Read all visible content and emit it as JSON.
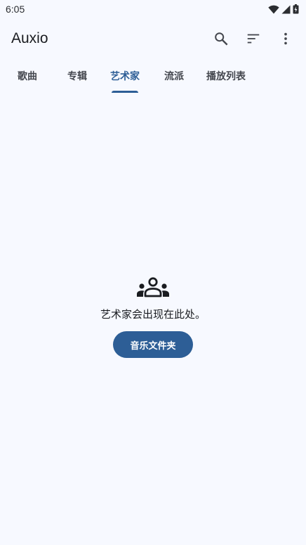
{
  "status_bar": {
    "time": "6:05",
    "icons": [
      "wifi-icon",
      "cellular-signal-icon",
      "battery-icon"
    ]
  },
  "app_bar": {
    "title": "Auxio",
    "actions": [
      "search-icon",
      "sort-icon",
      "more-vert-icon"
    ]
  },
  "tabs": [
    {
      "label": "歌曲",
      "active": false
    },
    {
      "label": "专辑",
      "active": false
    },
    {
      "label": "艺术家",
      "active": true
    },
    {
      "label": "流派",
      "active": false
    },
    {
      "label": "播放列表",
      "active": false
    }
  ],
  "empty_state": {
    "icon": "people-group-icon",
    "message": "艺术家会出现在此处。",
    "button_label": "音乐文件夹"
  },
  "colors": {
    "background": "#f7f9ff",
    "accent": "#2d5e96",
    "text_primary": "#1a1c20",
    "text_secondary": "#44474e"
  }
}
